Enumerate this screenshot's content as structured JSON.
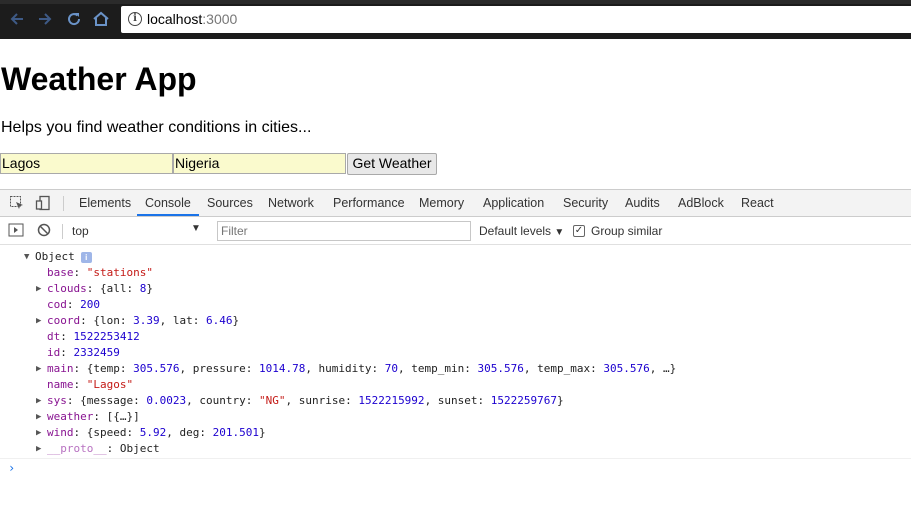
{
  "browser": {
    "url_host": "localhost",
    "url_port": ":3000"
  },
  "page": {
    "title": "Weather App",
    "subtitle": "Helps you find weather conditions in cities...",
    "city_value": "Lagos",
    "country_value": "Nigeria",
    "button_label": "Get Weather"
  },
  "devtools": {
    "tabs": [
      "Elements",
      "Console",
      "Sources",
      "Network",
      "Performance",
      "Memory",
      "Application",
      "Security",
      "Audits",
      "AdBlock",
      "React"
    ],
    "active_tab": "Console",
    "context": "top",
    "filter_placeholder": "Filter",
    "levels_label": "Default levels",
    "group_similar_label": "Group similar",
    "group_similar_checked": true
  },
  "console": {
    "object_label": "Object",
    "entries": {
      "base_key": "base",
      "base_val": "\"stations\"",
      "clouds_key": "clouds",
      "clouds_open": "{all: ",
      "clouds_num": "8",
      "clouds_close": "}",
      "cod_key": "cod",
      "cod_val": "200",
      "coord_key": "coord",
      "coord_a": "{lon: ",
      "coord_lon": "3.39",
      "coord_b": ", lat: ",
      "coord_lat": "6.46",
      "coord_c": "}",
      "dt_key": "dt",
      "dt_val": "1522253412",
      "id_key": "id",
      "id_val": "2332459",
      "main_key": "main",
      "main_a": "{temp: ",
      "main_temp": "305.576",
      "main_b": ", pressure: ",
      "main_pressure": "1014.78",
      "main_c": ", humidity: ",
      "main_humidity": "70",
      "main_d": ", temp_min: ",
      "main_tmin": "305.576",
      "main_e": ", temp_max: ",
      "main_tmax": "305.576",
      "main_f": ", …}",
      "name_key": "name",
      "name_val": "\"Lagos\"",
      "sys_key": "sys",
      "sys_a": "{message: ",
      "sys_msg": "0.0023",
      "sys_b": ", country: ",
      "sys_country": "\"NG\"",
      "sys_c": ", sunrise: ",
      "sys_sunrise": "1522215992",
      "sys_d": ", sunset: ",
      "sys_sunset": "1522259767",
      "sys_e": "}",
      "weather_key": "weather",
      "weather_val": "[{…}]",
      "wind_key": "wind",
      "wind_a": "{speed: ",
      "wind_speed": "5.92",
      "wind_b": ", deg: ",
      "wind_deg": "201.501",
      "wind_c": "}",
      "proto_key": "__proto__",
      "proto_val": "Object"
    }
  },
  "icons": {
    "back": "arrow-left-icon",
    "forward": "arrow-right-icon",
    "reload": "reload-icon",
    "home": "home-icon",
    "info": "info-icon"
  }
}
